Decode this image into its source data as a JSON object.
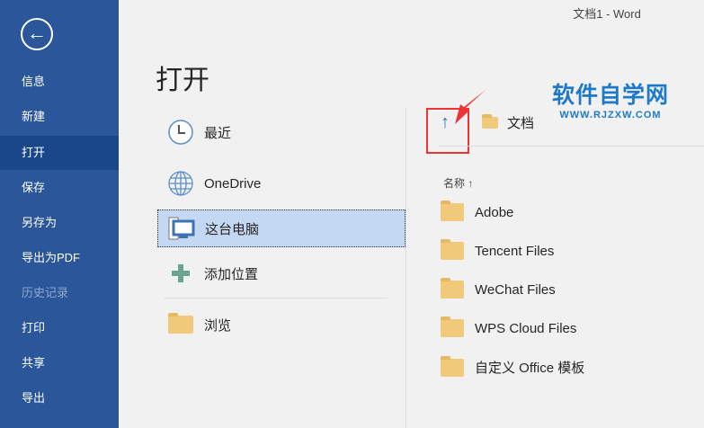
{
  "window": {
    "title": "文档1 - Word"
  },
  "sidebar": {
    "items": [
      {
        "label": "信息"
      },
      {
        "label": "新建"
      },
      {
        "label": "打开"
      },
      {
        "label": "保存"
      },
      {
        "label": "另存为"
      },
      {
        "label": "导出为PDF"
      },
      {
        "label": "历史记录"
      },
      {
        "label": "打印"
      },
      {
        "label": "共享"
      },
      {
        "label": "导出"
      }
    ]
  },
  "page": {
    "title": "打开"
  },
  "locations": [
    {
      "label": "最近"
    },
    {
      "label": "OneDrive"
    },
    {
      "label": "这台电脑"
    },
    {
      "label": "添加位置"
    },
    {
      "label": "浏览"
    }
  ],
  "breadcrumb": {
    "folder": "文档"
  },
  "files": {
    "column": "名称",
    "sort_glyph": "↑",
    "items": [
      "Adobe",
      "Tencent Files",
      "WeChat Files",
      "WPS Cloud Files",
      "自定义 Office 模板"
    ]
  },
  "watermark": {
    "title": "软件自学网",
    "url": "WWW.RJZXW.COM"
  }
}
